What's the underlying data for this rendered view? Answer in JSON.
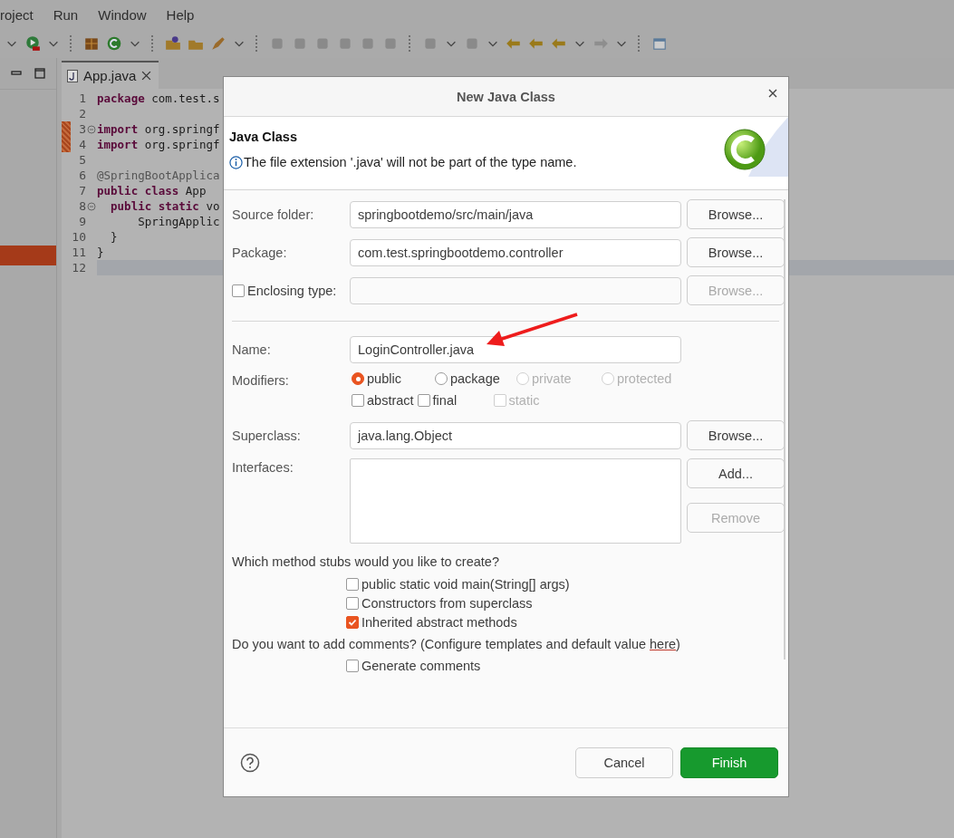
{
  "menu_bar": {
    "items": [
      "roject",
      "Run",
      "Window",
      "Help"
    ]
  },
  "editor": {
    "tab": {
      "label": "App.java",
      "selected": true
    },
    "lines": [
      {
        "number": "1",
        "fold": false,
        "changed": false,
        "current": false,
        "tokens": [
          {
            "kind": "keyword",
            "text": "package"
          },
          {
            "kind": "plain",
            "text": " com.test.s"
          }
        ]
      },
      {
        "number": "2",
        "fold": false,
        "changed": false,
        "current": false
      },
      {
        "number": "3",
        "fold": true,
        "changed": true,
        "current": false,
        "tokens": [
          {
            "kind": "keyword",
            "text": "import"
          },
          {
            "kind": "plain",
            "text": " org.springf"
          }
        ]
      },
      {
        "number": "4",
        "fold": false,
        "changed": true,
        "current": false,
        "tokens": [
          {
            "kind": "keyword",
            "text": "import"
          },
          {
            "kind": "plain",
            "text": " org.springf"
          }
        ]
      },
      {
        "number": "5",
        "fold": false,
        "changed": false,
        "current": false
      },
      {
        "number": "6",
        "fold": false,
        "changed": false,
        "current": false,
        "tokens": [
          {
            "kind": "annotation",
            "text": "@SpringBootApplica"
          }
        ]
      },
      {
        "number": "7",
        "fold": false,
        "changed": false,
        "current": false,
        "tokens": [
          {
            "kind": "keyword",
            "text": "public class"
          },
          {
            "kind": "plain",
            "text": " App"
          }
        ]
      },
      {
        "number": "8",
        "fold": true,
        "changed": false,
        "current": false,
        "tokens": [
          {
            "kind": "keyword",
            "text": "  public static"
          },
          {
            "kind": "plain",
            "text": " vo"
          }
        ]
      },
      {
        "number": "9",
        "fold": false,
        "changed": false,
        "current": false,
        "tokens": [
          {
            "kind": "plain",
            "text": "      SpringApplic"
          }
        ]
      },
      {
        "number": "10",
        "fold": false,
        "changed": false,
        "current": false,
        "tokens": [
          {
            "kind": "plain",
            "text": "  }"
          }
        ]
      },
      {
        "number": "11",
        "fold": false,
        "changed": false,
        "current": false,
        "tokens": [
          {
            "kind": "plain",
            "text": "}"
          }
        ]
      },
      {
        "number": "12",
        "fold": false,
        "changed": false,
        "current": true
      }
    ]
  },
  "dialog": {
    "title": "New Java Class",
    "header": {
      "title": "Java Class",
      "message": "The file extension '.java' will not be part of the type name."
    },
    "fields": [
      {
        "kind": "text",
        "label": "Source folder:",
        "value": "springbootdemo/src/main/java",
        "button": {
          "label": "Browse...",
          "disabled": false
        }
      },
      {
        "kind": "text",
        "label": "Package:",
        "value": "com.test.springbootdemo.controller",
        "button": {
          "label": "Browse...",
          "disabled": false
        }
      },
      {
        "kind": "checktext",
        "label": "Enclosing type:",
        "checked": false,
        "button": {
          "label": "Browse...",
          "disabled": true
        }
      },
      {
        "kind": "separator"
      },
      {
        "kind": "text",
        "label": "Name:",
        "value": "LoginController.java"
      },
      {
        "kind": "modifiers",
        "label": "Modifiers:",
        "radios": [
          {
            "label": "public",
            "selected": true,
            "disabled": false
          },
          {
            "label": "package",
            "selected": false,
            "disabled": false
          },
          {
            "label": "private",
            "selected": false,
            "disabled": true
          },
          {
            "label": "protected",
            "selected": false,
            "disabled": true
          }
        ],
        "checks": [
          {
            "label": "abstract",
            "checked": false,
            "disabled": false
          },
          {
            "label": "final",
            "checked": false,
            "disabled": false
          },
          {
            "label": "static",
            "checked": false,
            "disabled": true
          }
        ]
      },
      {
        "kind": "text",
        "label": "Superclass:",
        "value": "java.lang.Object",
        "button": {
          "label": "Browse...",
          "disabled": false
        }
      },
      {
        "kind": "list",
        "label": "Interfaces:",
        "buttons": [
          {
            "label": "Add...",
            "disabled": false
          },
          {
            "label": "Remove",
            "disabled": true
          }
        ]
      }
    ],
    "stubs": {
      "question": "Which method stubs would you like to create?",
      "options": [
        {
          "label": "public static void main(String[] args)",
          "checked": false
        },
        {
          "label": "Constructors from superclass",
          "checked": false
        },
        {
          "label": "Inherited abstract methods",
          "checked": true
        }
      ]
    },
    "comments": {
      "text": "Do you want to add comments? (Configure templates and default value ",
      "link": "here",
      "text_end": ")",
      "options": [
        {
          "label": "Generate comments",
          "checked": false
        }
      ]
    },
    "buttons": [
      {
        "label": "Cancel",
        "kind": "secondary"
      },
      {
        "label": "Finish",
        "kind": "primary"
      }
    ]
  }
}
